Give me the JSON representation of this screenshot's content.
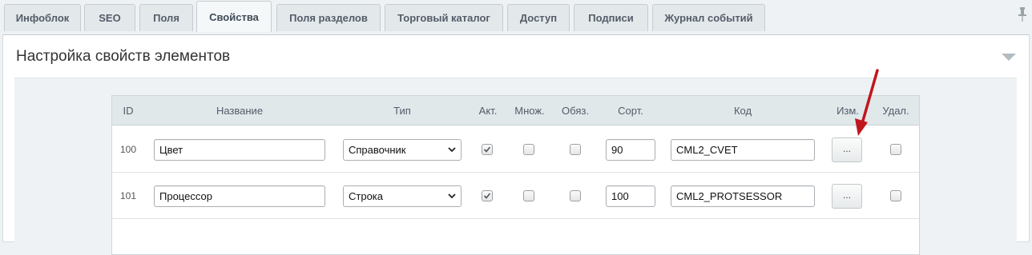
{
  "tabs": [
    {
      "label": "Инфоблок",
      "active": false
    },
    {
      "label": "SEO",
      "active": false
    },
    {
      "label": "Поля",
      "active": false
    },
    {
      "label": "Свойства",
      "active": true
    },
    {
      "label": "Поля разделов",
      "active": false
    },
    {
      "label": "Торговый каталог",
      "active": false
    },
    {
      "label": "Доступ",
      "active": false
    },
    {
      "label": "Подписи",
      "active": false
    },
    {
      "label": "Журнал событий",
      "active": false
    }
  ],
  "panel": {
    "title": "Настройка свойств элементов"
  },
  "table": {
    "headers": {
      "id": "ID",
      "name": "Название",
      "type": "Тип",
      "active": "Акт.",
      "multiple": "Множ.",
      "required": "Обяз.",
      "sort": "Сорт.",
      "code": "Код",
      "edit": "Изм.",
      "delete": "Удал."
    },
    "rows": [
      {
        "id": "100",
        "name": "Цвет",
        "type": "Справочник",
        "active": true,
        "multiple": false,
        "required": false,
        "sort": "90",
        "code": "CML2_CVET",
        "edit_label": "..."
      },
      {
        "id": "101",
        "name": "Процессор",
        "type": "Строка",
        "active": true,
        "multiple": false,
        "required": false,
        "sort": "100",
        "code": "CML2_PROTSESSOR",
        "edit_label": "..."
      }
    ]
  },
  "colors": {
    "accent_arrow": "#c0161d",
    "header_bg": "#e0e8ea"
  },
  "icons": {
    "pin": "pin-icon",
    "collapse": "chevron-down-icon",
    "check": "check-icon"
  }
}
